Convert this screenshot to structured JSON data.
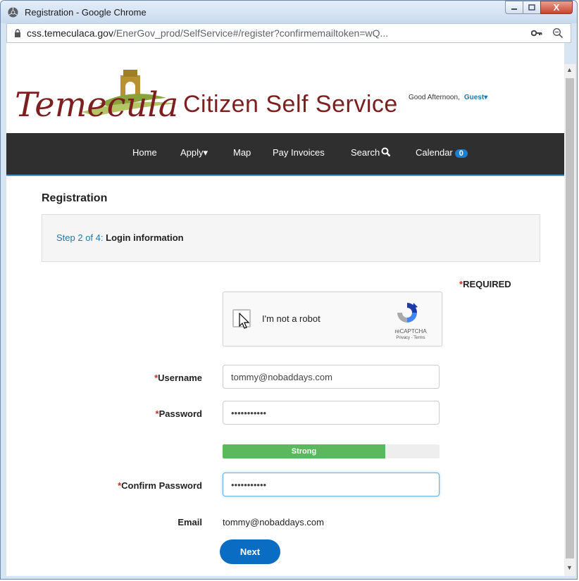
{
  "window": {
    "title": "Registration - Google Chrome",
    "controls": {
      "minimize": "–",
      "maximize": "□",
      "close": "X"
    }
  },
  "address_bar": {
    "host": "css.temeculaca.gov",
    "path": "/EnerGov_prod/SelfService#/register?confirmemailtoken=wQ..."
  },
  "header": {
    "logo_text": "Temecula",
    "site_title": "Citizen Self Service",
    "greeting": "Good Afternoon,",
    "user": "Guest"
  },
  "nav": {
    "home": "Home",
    "apply": "Apply",
    "map": "Map",
    "pay_invoices": "Pay Invoices",
    "search": "Search",
    "calendar": "Calendar",
    "calendar_count": "0"
  },
  "page": {
    "title": "Registration",
    "step_number": "Step 2 of 4:",
    "step_label": "Login information",
    "required_label": "REQUIRED",
    "required_star": "*"
  },
  "recaptcha": {
    "label": "I'm not a robot",
    "brand": "reCAPTCHA",
    "links": "Privacy - Terms"
  },
  "form": {
    "username_label": "Username",
    "username_value": "tommy@nobaddays.com",
    "password_label": "Password",
    "password_value": "•••••••••••",
    "strength_label": "Strong",
    "strength_fraction": 0.75,
    "confirm_label": "Confirm Password",
    "confirm_value": "•••••••••••",
    "email_label": "Email",
    "email_value": "tommy@nobaddays.com",
    "next_button": "Next"
  },
  "colors": {
    "brand_red": "#7d1f1f",
    "link_blue": "#1a7ab0",
    "nav_bg": "#2f2f2f",
    "button_blue": "#0a6cc2",
    "strength_green": "#5cb85c",
    "required_red": "#c8321e"
  },
  "icons": {
    "chrome": "chrome-icon",
    "lock": "lock-icon",
    "key": "key-icon",
    "zoom": "zoom-icon",
    "search": "search-icon",
    "caret": "caret-down-icon",
    "recaptcha": "recaptcha-logo"
  }
}
